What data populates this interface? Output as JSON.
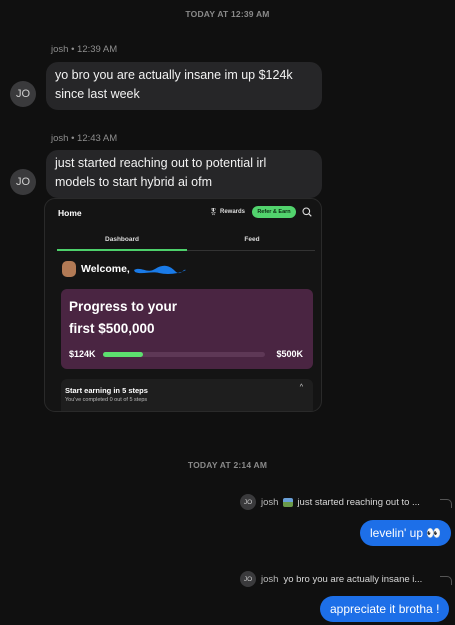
{
  "dividers": {
    "first": "TODAY AT 12:39 AM",
    "second": "TODAY AT 2:14 AM"
  },
  "messages": [
    {
      "meta": "josh • 12:39 AM",
      "avatar": "JO",
      "lines": [
        "yo bro you are actually insane im up $124k",
        "since last week"
      ]
    },
    {
      "meta": "josh • 12:43 AM",
      "avatar": "JO",
      "lines": [
        "just started reaching out to potential irl",
        "models to start hybrid ai ofm"
      ]
    }
  ],
  "screenshot": {
    "nav": {
      "home": "Home",
      "rewards": "Rewards",
      "refer": "Refer & Earn"
    },
    "tabs": [
      "Dashboard",
      "Feed"
    ],
    "welcome": "Welcome,",
    "progress": {
      "title_line1": "Progress to your",
      "title_line2": "first $500,000",
      "from": "$124K",
      "to": "$500K",
      "fraction": 0.248
    },
    "steps": {
      "title": "Start earning in 5 steps",
      "subtitle": "You've completed 0 out of 5 steps"
    }
  },
  "replies": [
    {
      "avatar": "JO",
      "name": "josh",
      "quoted": "just started reaching out to ...",
      "has_image": true,
      "reply": "levelin' up 👀"
    },
    {
      "avatar": "JO",
      "name": "josh",
      "quoted": "yo bro you are actually insane i...",
      "has_image": false,
      "reply": "appreciate it brotha !"
    }
  ],
  "colors": {
    "background": "#101010",
    "incoming_bubble": "#262628",
    "outgoing_bubble": "#1d6fe8",
    "accent_green": "#52d36d",
    "progress_card": "#4a2542"
  }
}
